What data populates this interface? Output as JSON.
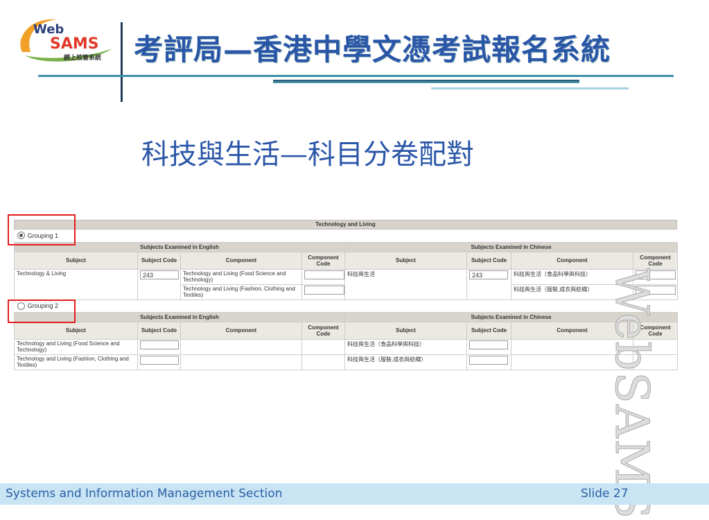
{
  "logo": {
    "line1": "Web",
    "line2": "SAMS",
    "line3": "網上校管系統"
  },
  "title": "考評局—香港中學文憑考試報名系統",
  "subtitle": "科技與生活—科目分卷配對",
  "table": {
    "caption": "Technology and Living",
    "groups": [
      {
        "label": "Grouping 1",
        "selected": true
      },
      {
        "label": "Grouping 2",
        "selected": false
      }
    ],
    "section_en": "Subjects Examined in English",
    "section_zh": "Subjects Examined in Chinese",
    "headers": {
      "subject": "Subject",
      "subject_code": "Subject Code",
      "component": "Component",
      "component_code": "Component Code"
    },
    "g1": {
      "subject_en": "Technology & Living",
      "code_en": "243",
      "comp1_en": "Technology and Living (Food Science and Technology)",
      "comp2_en": "Technology and Living (Fashion, Clothing and Textiles)",
      "subject_zh": "科技與生活",
      "code_zh": "243",
      "comp1_zh": "科技與生活（食品科學與科技）",
      "comp2_zh": "科技與生活（服裝,成衣與紡織）"
    },
    "g2": {
      "row1_en": "Technology and Living (Food Science and Technology)",
      "row2_en": "Technology and Living (Fashion, Clothing and Textiles)",
      "row1_zh": "科技與生活（食品科學與科技）",
      "row2_zh": "科技與生活（服裝,成衣與紡織）"
    }
  },
  "watermark": "WebSAMS",
  "footer": {
    "left": "Systems and Information Management Section",
    "right": "Slide 27"
  },
  "colors": {
    "title": "#2a56a8",
    "footer_bg": "#c9e4f3",
    "highlight": "#e21b1b"
  }
}
